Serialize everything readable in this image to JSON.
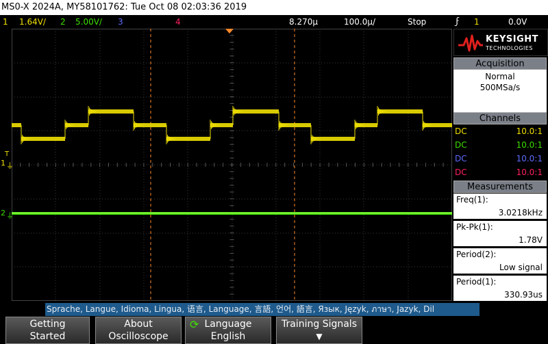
{
  "title": "MS0-X 2024A, MY58101762: Tue Oct 08 02:03:36 2019",
  "status": {
    "ch1_num": "1",
    "ch1_scale": "1.64V/",
    "ch2_num": "2",
    "ch2_scale": "5.00V/",
    "ch3_num": "3",
    "ch4_num": "4",
    "timebase": "8.270µ",
    "timescale": "100.0µ/",
    "run_state": "Stop",
    "trigger_symbol": "ϝ",
    "trigger_ch": "1",
    "trigger_level": "0.0V"
  },
  "brand": {
    "name": "KEYSIGHT",
    "sub": "TECHNOLOGIES"
  },
  "acquisition": {
    "header": "Acquisition",
    "mode": "Normal",
    "rate": "500MSa/s"
  },
  "channels": {
    "header": "Channels",
    "rows": [
      {
        "coupling": "DC",
        "probe": "10.0:1",
        "color": "#f0e000"
      },
      {
        "coupling": "DC",
        "probe": "10.0:1",
        "color": "#3ee000"
      },
      {
        "coupling": "DC",
        "probe": "10.0:1",
        "color": "#5f6cff"
      },
      {
        "coupling": "DC",
        "probe": "10.0:1",
        "color": "#ff2060"
      }
    ]
  },
  "measurements": {
    "header": "Measurements",
    "items": [
      {
        "label": "Freq(1):",
        "value": "3.0218kHz"
      },
      {
        "label": "Pk-Pk(1):",
        "value": "1.78V"
      },
      {
        "label": "Period(2):",
        "value": "Low signal"
      },
      {
        "label": "Period(1):",
        "value": "330.93us"
      }
    ]
  },
  "ground_markers": {
    "ch1": "1",
    "ch2": "2",
    "trigger": "T"
  },
  "language_bar": "Sprache, Langue, Idioma, Lingua, 语言, Language, 言語, 언어, 語言, Язык, Język, ภาษา, Jazyk, Dil",
  "softkeys": {
    "k1": {
      "line1": "Getting",
      "line2": "Started"
    },
    "k2": {
      "line1": "About",
      "line2": "Oscilloscope"
    },
    "k3": {
      "line1": "Language",
      "line2": "English"
    },
    "k4": {
      "line1": "Training Signals"
    }
  },
  "colors": {
    "ch1": "#f0e000",
    "ch2": "#3ee000",
    "ch3": "#5f6cff",
    "ch4": "#ff2060",
    "cursor": "#ff8a2a",
    "grid": "#3a3a3a"
  }
}
